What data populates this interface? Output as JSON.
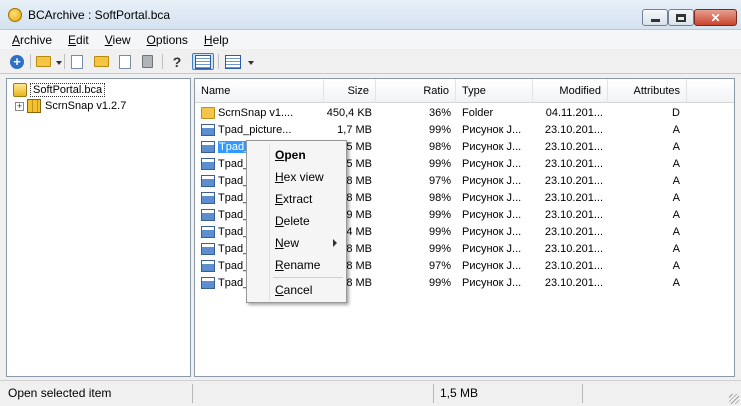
{
  "window": {
    "title": "BCArchive : SoftPortal.bca"
  },
  "menu": [
    {
      "label_u": "A",
      "label_rest": "rchive"
    },
    {
      "label_u": "E",
      "label_rest": "dit"
    },
    {
      "label_u": "V",
      "label_rest": "iew"
    },
    {
      "label_u": "O",
      "label_rest": "ptions"
    },
    {
      "label_u": "H",
      "label_rest": "elp"
    }
  ],
  "tree": {
    "root": "SoftPortal.bca",
    "child": "ScrnSnap v1.2.7"
  },
  "columns": [
    "Name",
    "Size",
    "Ratio",
    "Type",
    "Modified",
    "Attributes"
  ],
  "files": [
    {
      "name": "ScrnSnap v1....",
      "size": "450,4 KB",
      "ratio": "36%",
      "type": "Folder",
      "modified": "04.11.201...",
      "attr": "D",
      "icon": "folder-icon"
    },
    {
      "name": "Tpad_picture...",
      "size": "1,7 MB",
      "ratio": "99%",
      "type": "Рисунок J...",
      "modified": "23.10.201...",
      "attr": "A",
      "icon": "image-file-icon"
    },
    {
      "name": "Tpad_",
      "size": "5 MB",
      "ratio": "98%",
      "type": "Рисунок J...",
      "modified": "23.10.201...",
      "attr": "A",
      "icon": "image-file-icon",
      "selected": true
    },
    {
      "name": "Tpad_",
      "size": "5 MB",
      "ratio": "99%",
      "type": "Рисунок J...",
      "modified": "23.10.201...",
      "attr": "A",
      "icon": "image-file-icon"
    },
    {
      "name": "Tpad_",
      "size": "8 MB",
      "ratio": "97%",
      "type": "Рисунок J...",
      "modified": "23.10.201...",
      "attr": "A",
      "icon": "image-file-icon"
    },
    {
      "name": "Tpad_",
      "size": "8 MB",
      "ratio": "98%",
      "type": "Рисунок J...",
      "modified": "23.10.201...",
      "attr": "A",
      "icon": "image-file-icon"
    },
    {
      "name": "Tpad_",
      "size": "9 MB",
      "ratio": "99%",
      "type": "Рисунок J...",
      "modified": "23.10.201...",
      "attr": "A",
      "icon": "image-file-icon"
    },
    {
      "name": "Tpad_",
      "size": "4 MB",
      "ratio": "99%",
      "type": "Рисунок J...",
      "modified": "23.10.201...",
      "attr": "A",
      "icon": "image-file-icon"
    },
    {
      "name": "Tpad_",
      "size": "8 MB",
      "ratio": "99%",
      "type": "Рисунок J...",
      "modified": "23.10.201...",
      "attr": "A",
      "icon": "image-file-icon"
    },
    {
      "name": "Tpad_",
      "size": "8 MB",
      "ratio": "97%",
      "type": "Рисунок J...",
      "modified": "23.10.201...",
      "attr": "A",
      "icon": "image-file-icon"
    },
    {
      "name": "Tpad_",
      "size": "8 MB",
      "ratio": "99%",
      "type": "Рисунок J...",
      "modified": "23.10.201...",
      "attr": "A",
      "icon": "image-file-icon"
    }
  ],
  "context_menu": [
    {
      "label_u": "O",
      "label_rest": "pen",
      "bold": true
    },
    {
      "label_u": "H",
      "label_rest": "ex view"
    },
    {
      "label_u": "E",
      "label_rest": "xtract"
    },
    {
      "label_u": "D",
      "label_rest": "elete"
    },
    {
      "label_u": "N",
      "label_rest": "ew",
      "submenu": true
    },
    {
      "label_u": "R",
      "label_rest": "ename"
    },
    {
      "label_u": "C",
      "label_rest": "ancel"
    }
  ],
  "status": {
    "left": "Open selected item",
    "middle": "1,5 MB"
  },
  "toolbar_icons": [
    "add-icon",
    "archive-folder-icon",
    "add-files-icon",
    "extract-icon",
    "copy-icon",
    "delete-icon",
    "help-icon",
    "details-view-icon",
    "view-mode-icon"
  ],
  "colors": {
    "selection": "#3399ff",
    "folder": "#f3c54a"
  }
}
